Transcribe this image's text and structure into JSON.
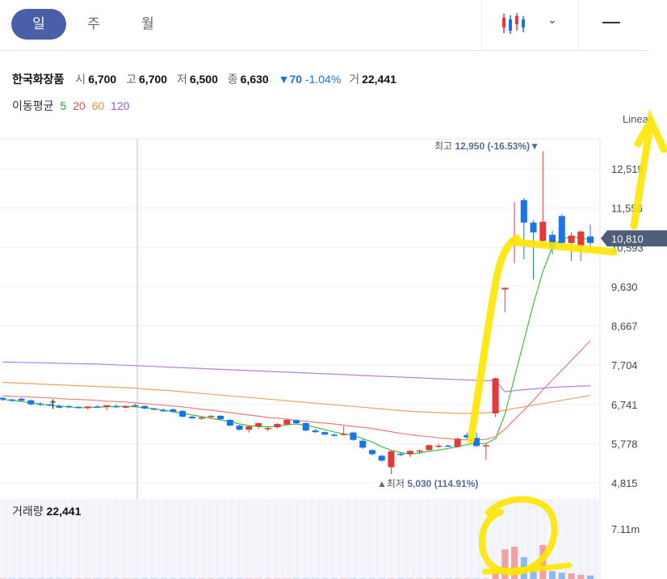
{
  "tabs": [
    {
      "label": "일",
      "active": true
    },
    {
      "label": "주",
      "active": false
    },
    {
      "label": "월",
      "active": false
    }
  ],
  "icons": {
    "chart_type": "candlestick-icon",
    "dropdown": "chevron-down-icon",
    "menu": "minus-icon"
  },
  "stock": {
    "name": "한국화장품",
    "open_label": "시",
    "open": "6,700",
    "high_label": "고",
    "high": "6,700",
    "low_label": "저",
    "low": "6,500",
    "close_label": "종",
    "close": "6,630",
    "change": "▼70",
    "change_pct": "-1.04%",
    "volume_label": "거",
    "volume": "22,441"
  },
  "moving_average": {
    "label": "이동평균",
    "periods": [
      {
        "label": "5",
        "color": "#2ca02c"
      },
      {
        "label": "20",
        "color": "#e0504b"
      },
      {
        "label": "60",
        "color": "#e8913a"
      },
      {
        "label": "120",
        "color": "#9b59d6"
      }
    ]
  },
  "scale_label": "Linear",
  "colors": {
    "up": "#e5383b",
    "down": "#1a73e8",
    "highlight": "#ffe600",
    "grid": "#eef0f3",
    "current_price_bg": "#4e5d78"
  },
  "chart_data": {
    "type": "candlestick",
    "ylim": [
      4600,
      13400
    ],
    "y_ticks": [
      "12,519",
      "11,556",
      "10,593",
      "9,630",
      "8,667",
      "7,704",
      "6,741",
      "5,778",
      "4,815"
    ],
    "current_price": "10,810",
    "max_label": "최고",
    "max_value": "12,950 (-16.53%)",
    "min_label": "최저",
    "min_value": "5,030 (114.91%)",
    "candles": [
      [
        6900,
        6920,
        6820,
        6860
      ],
      [
        6860,
        6880,
        6800,
        6840
      ],
      [
        6880,
        6900,
        6820,
        6830
      ],
      [
        6840,
        6860,
        6720,
        6740
      ],
      [
        6760,
        6800,
        6700,
        6730
      ],
      [
        6740,
        6760,
        6700,
        6720
      ],
      [
        6700,
        6740,
        6640,
        6660
      ],
      [
        6700,
        6720,
        6640,
        6670
      ],
      [
        6680,
        6700,
        6640,
        6660
      ],
      [
        6650,
        6700,
        6620,
        6690
      ],
      [
        6690,
        6720,
        6660,
        6680
      ],
      [
        6680,
        6720,
        6600,
        6720
      ],
      [
        6700,
        6740,
        6650,
        6680
      ],
      [
        6660,
        6720,
        6640,
        6700
      ],
      [
        6720,
        6760,
        6680,
        6690
      ],
      [
        6700,
        6720,
        6620,
        6640
      ],
      [
        6640,
        6660,
        6600,
        6620
      ],
      [
        6600,
        6640,
        6560,
        6580
      ],
      [
        6620,
        6640,
        6540,
        6560
      ],
      [
        6580,
        6600,
        6420,
        6440
      ],
      [
        6440,
        6460,
        6380,
        6400
      ],
      [
        6400,
        6440,
        6360,
        6420
      ],
      [
        6440,
        6480,
        6400,
        6460
      ],
      [
        6460,
        6480,
        6360,
        6380
      ],
      [
        6360,
        6380,
        6200,
        6220
      ],
      [
        6220,
        6240,
        6100,
        6120
      ],
      [
        6120,
        6220,
        6050,
        6200
      ],
      [
        6200,
        6300,
        6140,
        6280
      ],
      [
        6140,
        6200,
        6080,
        6160
      ],
      [
        6180,
        6280,
        6150,
        6260
      ],
      [
        6250,
        6380,
        6230,
        6360
      ],
      [
        6350,
        6370,
        6260,
        6280
      ],
      [
        6280,
        6300,
        6080,
        6100
      ],
      [
        6100,
        6140,
        6040,
        6060
      ],
      [
        6060,
        6080,
        5980,
        6000
      ],
      [
        6000,
        6030,
        5950,
        5980
      ],
      [
        5990,
        6200,
        5970,
        6020
      ],
      [
        6050,
        6070,
        5850,
        5870
      ],
      [
        5850,
        5900,
        5650,
        5680
      ],
      [
        5620,
        5640,
        5490,
        5520
      ],
      [
        5480,
        5500,
        5340,
        5360
      ],
      [
        5200,
        5620,
        5030,
        5590
      ],
      [
        5530,
        5570,
        5470,
        5510
      ],
      [
        5520,
        5620,
        5450,
        5600
      ],
      [
        5590,
        5640,
        5520,
        5610
      ],
      [
        5620,
        5760,
        5610,
        5740
      ],
      [
        5700,
        5780,
        5660,
        5730
      ],
      [
        5730,
        5760,
        5700,
        5710
      ],
      [
        5700,
        5920,
        5680,
        5900
      ],
      [
        5990,
        6050,
        5880,
        5930
      ],
      [
        5920,
        6050,
        5700,
        5720
      ],
      [
        5720,
        5800,
        5380,
        5740
      ],
      [
        6520,
        7400,
        6430,
        7380
      ],
      [
        9560,
        9590,
        9000,
        9600
      ],
      [
        10700,
        11700,
        10200,
        10800
      ],
      [
        11750,
        11800,
        10300,
        11200
      ],
      [
        11200,
        11260,
        9800,
        10960
      ],
      [
        10750,
        12950,
        10700,
        11220
      ],
      [
        10900,
        11000,
        10420,
        10560
      ],
      [
        11360,
        11400,
        10600,
        10700
      ],
      [
        10700,
        10960,
        10260,
        10880
      ],
      [
        10620,
        11000,
        10250,
        10980
      ],
      [
        10860,
        11150,
        10500,
        10700
      ]
    ],
    "ma5": [
      6860,
      6840,
      6810,
      6780,
      6750,
      6720,
      6700,
      6680,
      6660,
      6660,
      6670,
      6680,
      6690,
      6690,
      6680,
      6660,
      6630,
      6600,
      6560,
      6520,
      6480,
      6440,
      6400,
      6360,
      6320,
      6260,
      6220,
      6200,
      6190,
      6210,
      6240,
      6260,
      6230,
      6180,
      6120,
      6060,
      6020,
      5980,
      5900,
      5820,
      5700,
      5620,
      5560,
      5520,
      5550,
      5590,
      5620,
      5660,
      5700,
      5760,
      5780,
      5780,
      5900,
      6500,
      7400,
      8300,
      9200,
      10000,
      10600,
      10800,
      10850,
      10820,
      10780
    ],
    "ma20": [
      6950,
      6940,
      6930,
      6920,
      6910,
      6900,
      6880,
      6870,
      6860,
      6850,
      6840,
      6820,
      6810,
      6800,
      6780,
      6760,
      6740,
      6720,
      6700,
      6680,
      6650,
      6620,
      6600,
      6570,
      6540,
      6510,
      6480,
      6450,
      6420,
      6400,
      6380,
      6350,
      6330,
      6300,
      6280,
      6260,
      6230,
      6200,
      6180,
      6150,
      6110,
      6070,
      6030,
      6000,
      5970,
      5950,
      5920,
      5900,
      5880,
      5870,
      5870,
      5880,
      5950,
      6130,
      6370,
      6600,
      6840,
      7100,
      7340,
      7580,
      7820,
      8060,
      8300
    ],
    "ma60": [
      7280,
      7270,
      7260,
      7250,
      7240,
      7230,
      7220,
      7210,
      7200,
      7190,
      7180,
      7170,
      7160,
      7150,
      7140,
      7120,
      7100,
      7090,
      7070,
      7050,
      7030,
      7010,
      6990,
      6970,
      6950,
      6930,
      6910,
      6890,
      6870,
      6850,
      6830,
      6810,
      6790,
      6770,
      6750,
      6730,
      6710,
      6690,
      6670,
      6650,
      6630,
      6610,
      6590,
      6570,
      6560,
      6550,
      6540,
      6530,
      6520,
      6520,
      6520,
      6530,
      6560,
      6600,
      6640,
      6680,
      6720,
      6760,
      6800,
      6840,
      6880,
      6920,
      6960
    ],
    "ma120": [
      7780,
      7775,
      7770,
      7765,
      7760,
      7755,
      7750,
      7745,
      7740,
      7735,
      7730,
      7720,
      7710,
      7700,
      7690,
      7680,
      7670,
      7660,
      7650,
      7640,
      7630,
      7620,
      7610,
      7600,
      7590,
      7580,
      7570,
      7560,
      7550,
      7540,
      7530,
      7520,
      7510,
      7500,
      7490,
      7480,
      7470,
      7460,
      7450,
      7440,
      7430,
      7420,
      7410,
      7400,
      7390,
      7380,
      7370,
      7360,
      7350,
      7340,
      7330,
      7320,
      7330,
      7050,
      7080,
      7100,
      7120,
      7140,
      7160,
      7170,
      7180,
      7190,
      7200
    ],
    "volume": {
      "label": "거래량",
      "last": "22,441",
      "max_tick": "7.11m",
      "values": [
        0.05,
        0.05,
        0.05,
        0.05,
        0.05,
        0.05,
        0.05,
        0.05,
        0.05,
        0.05,
        0.05,
        0.05,
        0.05,
        0.05,
        0.05,
        0.05,
        0.05,
        0.05,
        0.05,
        0.05,
        0.05,
        0.05,
        0.05,
        0.05,
        0.05,
        0.05,
        0.05,
        0.05,
        0.05,
        0.05,
        0.05,
        0.05,
        0.05,
        0.05,
        0.05,
        0.05,
        0.05,
        0.05,
        0.05,
        0.05,
        0.05,
        0.05,
        0.05,
        0.05,
        0.05,
        0.05,
        0.05,
        0.05,
        0.05,
        0.05,
        0.05,
        0.05,
        0.8,
        4.2,
        4.6,
        3.1,
        1.6,
        4.8,
        1.1,
        0.9,
        0.8,
        0.6,
        0.5
      ],
      "up_flags": [
        true,
        false,
        false,
        false,
        false,
        false,
        false,
        false,
        true,
        true,
        false,
        true,
        false,
        true,
        false,
        false,
        false,
        false,
        false,
        false,
        false,
        true,
        true,
        false,
        false,
        false,
        true,
        true,
        true,
        true,
        true,
        false,
        false,
        false,
        false,
        false,
        true,
        false,
        false,
        false,
        false,
        true,
        false,
        true,
        true,
        true,
        true,
        false,
        true,
        true,
        false,
        true,
        true,
        true,
        true,
        false,
        false,
        true,
        false,
        false,
        true,
        true,
        false
      ]
    }
  }
}
